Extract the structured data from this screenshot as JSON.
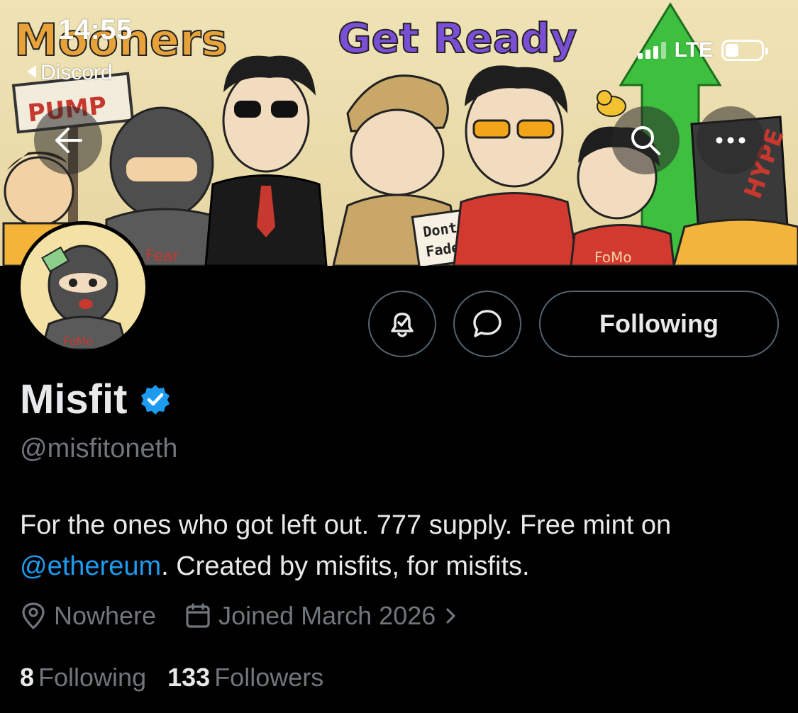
{
  "status_bar": {
    "time": "14:55",
    "back_app": "Discord",
    "network": "LTE"
  },
  "banner": {
    "title_left": "Mooners",
    "title_right": "Get Ready",
    "sign_text": "PUMP",
    "shirt_text_1": "Fear",
    "note_text_line1": "Dont",
    "note_text_line2": "Fade",
    "shirt_text_2": "FoMo",
    "bag_text": "HYPE"
  },
  "avatar": {
    "shirt_text": "FoMo"
  },
  "actions": {
    "following_label": "Following"
  },
  "profile": {
    "display_name": "Misfit",
    "handle": "@misfitoneth",
    "bio_part1": "For the ones who got left out. 777 supply. Free mint on",
    "bio_mention": "@ethereum",
    "bio_part2": ". Created by misfits, for misfits.",
    "location": "Nowhere",
    "joined": "Joined March 2026",
    "following_count": "8",
    "following_label": "Following",
    "followers_count": "133",
    "followers_label": "Followers"
  },
  "colors": {
    "accent": "#1d9bf0",
    "secondary_text": "#71767b",
    "primary_text": "#e7e9ea",
    "button_border": "#536471",
    "background": "#000000",
    "verified_badge": "#1d9bf0"
  },
  "icons": [
    "back-arrow-icon",
    "search-icon",
    "more-icon",
    "bell-check-icon",
    "message-icon",
    "verified-badge-icon",
    "location-pin-icon",
    "calendar-icon",
    "chevron-right-icon"
  ]
}
